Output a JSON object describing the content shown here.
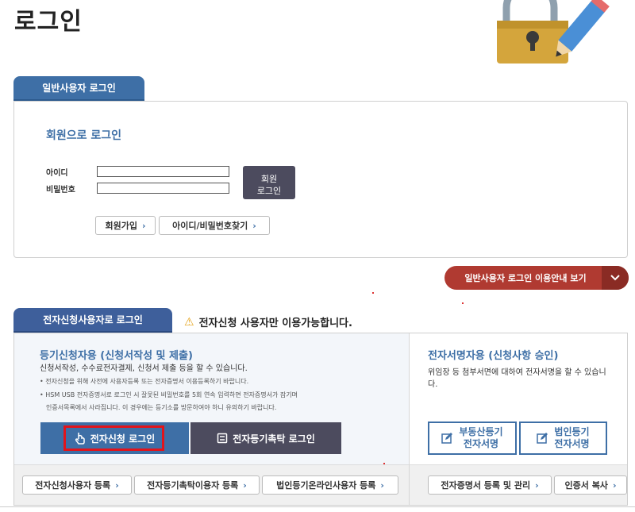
{
  "page": {
    "title": "로그인"
  },
  "general_tab": {
    "label": "일반사용자 로그인"
  },
  "member_login": {
    "title": "회원으로 로그인",
    "id_label": "아이디",
    "pw_label": "비밀번호",
    "id_value": "",
    "pw_value": "",
    "login_button": "회원\n로그인",
    "signup_button": "회원가입",
    "find_button": "아이디/비밀번호찾기"
  },
  "guide_button": {
    "label": "일반사용자 로그인 이용안내 보기"
  },
  "esign_tab": {
    "label": "전자신청사용자로 로그인"
  },
  "notice": {
    "text": "전자신청 사용자만 이용가능합니다."
  },
  "registry_section": {
    "title": "등기신청자용 (신청서작성 및 제출)",
    "description": "신청서작성, 수수료전자결제, 신청서 제출 등을 할 수 있습니다.",
    "note1": "• 전자신청을 위해 사전에 사용자등록 또는 전자증명서 이용등록하기 바랍니다.",
    "note2": "• HSM USB 전자증명서로 로그인 시 잘못된 비밀번호를 5회 연속 입력하면 전자증명서가 잠기며",
    "note3": "인증서목록에서 사라집니다. 이 경우에는 등기소를 방문하여야 하니 유의하기 바랍니다.",
    "esign_login_button": "전자신청 로그인",
    "trust_login_button": "전자등기촉탁 로그인"
  },
  "signature_section": {
    "title": "전자서명자용 (신청사항 승인)",
    "description": "위임장 등 첨부서면에 대하여 전자서명을 할 수 있습니다.",
    "realestate_button": "부동산등기\n전자서명",
    "corporate_button": "법인등기\n전자서명"
  },
  "bottom_links": [
    {
      "label": "전자신청사용자 등록"
    },
    {
      "label": "전자등기촉탁이용자 등록"
    },
    {
      "label": "법인등기온라인사용자 등록"
    },
    {
      "label": "전자증명서 등록 및 관리"
    },
    {
      "label": "인증서 복사"
    }
  ],
  "chevron_glyph": "›",
  "colors": {
    "primary": "#3e6fa6",
    "dark": "#4c4b5e",
    "accent_red": "#b03a31",
    "highlight": "#e2141b"
  },
  "icons": [
    "lock-pencil-illustration",
    "warning-icon",
    "touch-icon",
    "monitor-icon",
    "edit-icon",
    "chevron-down-icon",
    "chevron-right-icon"
  ]
}
